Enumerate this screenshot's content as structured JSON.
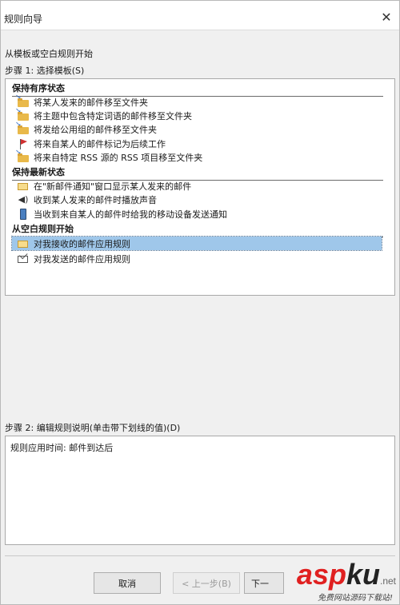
{
  "window": {
    "title": "规则向导",
    "close_glyph": "✕"
  },
  "start_label": "从模板或空白规则开始",
  "step1_label": "步骤 1: 选择模板(S)",
  "step2_label": "步骤 2: 编辑规则说明(单击带下划线的值)(D)",
  "groups": {
    "organized": "保持有序状态",
    "uptodate": "保持最新状态",
    "blank": "从空白规则开始"
  },
  "templates": {
    "organized": [
      {
        "label": "将某人发来的邮件移至文件夹",
        "icon": "folder-move-icon"
      },
      {
        "label": "将主题中包含特定词语的邮件移至文件夹",
        "icon": "folder-move-icon"
      },
      {
        "label": "将发给公用组的邮件移至文件夹",
        "icon": "folder-move-icon"
      },
      {
        "label": "将来自某人的邮件标记为后续工作",
        "icon": "flag-icon"
      },
      {
        "label": "将来自特定 RSS 源的 RSS 项目移至文件夹",
        "icon": "folder-move-icon"
      }
    ],
    "uptodate": [
      {
        "label": "在\"新邮件通知\"窗口显示某人发来的邮件",
        "icon": "new-mail-alert-icon"
      },
      {
        "label": "收到某人发来的邮件时播放声音",
        "icon": "speaker-icon"
      },
      {
        "label": "当收到来自某人的邮件时给我的移动设备发送通知",
        "icon": "mobile-device-icon"
      }
    ],
    "blank": [
      {
        "label": "对我接收的邮件应用规则",
        "icon": "incoming-mail-icon",
        "selected": true
      },
      {
        "label": "对我发送的邮件应用规则",
        "icon": "outgoing-mail-icon",
        "selected": false
      }
    ]
  },
  "description": {
    "text": "规则应用时间: 邮件到达后"
  },
  "buttons": {
    "cancel": "取消",
    "back": "< 上一步(B)",
    "next": "下一"
  },
  "watermark": {
    "asp": "asp",
    "ku": "ku",
    "net": ".net",
    "sub": "免费网站源码下载站!"
  }
}
